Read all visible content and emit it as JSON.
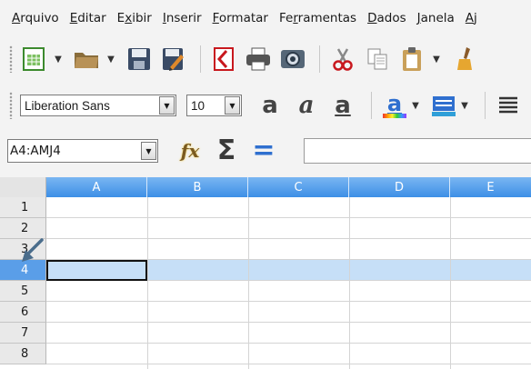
{
  "menu": {
    "items": [
      {
        "first": "A",
        "rest": "rquivo"
      },
      {
        "first": "E",
        "rest": "ditar"
      },
      {
        "first": "E",
        "mid": "x",
        "rest": "ibir"
      },
      {
        "first": "I",
        "rest": "nserir"
      },
      {
        "first": "F",
        "rest": "ormatar"
      },
      {
        "first": "Fe",
        "mid": "r",
        "rest": "ramentas"
      },
      {
        "first": "D",
        "rest": "ados"
      },
      {
        "first": "J",
        "rest": "anela"
      },
      {
        "first": "A",
        "rest": "j"
      }
    ]
  },
  "font_toolbar": {
    "font_name": "Liberation Sans",
    "font_size": "10",
    "bold_glyph": "a",
    "italic_glyph": "a",
    "underline_glyph": "a",
    "font_color_glyph": "a"
  },
  "formula_bar": {
    "name_box": "A4:AMJ4",
    "function_glyph": "fx",
    "sum_glyph": "Σ",
    "equals_glyph": "="
  },
  "grid": {
    "columns": [
      "A",
      "B",
      "C",
      "D",
      "E"
    ],
    "rows": [
      "1",
      "2",
      "3",
      "4",
      "5",
      "6",
      "7",
      "8"
    ],
    "selected_row": "4"
  },
  "colors": {
    "column_header": "#3d8fe6",
    "selected_row": "#c6dff7",
    "selected_row_header": "#5a9ee8",
    "pointer_arrow": "#4a6d8c"
  }
}
